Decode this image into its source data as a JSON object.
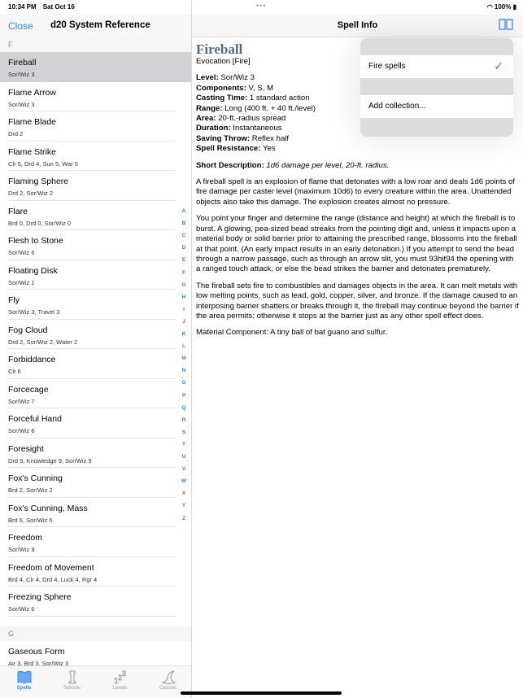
{
  "status": {
    "time": "10:34 PM",
    "date": "Sat Oct 16",
    "battery": "100%"
  },
  "left": {
    "close": "Close",
    "title": "d20 System Reference",
    "sections": [
      {
        "letter": "F",
        "items": [
          {
            "name": "Fireball",
            "sub": "Sor/Wiz 3",
            "selected": true
          },
          {
            "name": "Flame Arrow",
            "sub": "Sor/Wiz 3"
          },
          {
            "name": "Flame Blade",
            "sub": "Drd 2"
          },
          {
            "name": "Flame Strike",
            "sub": "Clr 5, Drd 4, Sun 5, War 5"
          },
          {
            "name": "Flaming Sphere",
            "sub": "Drd 2, Sor/Wiz 2"
          },
          {
            "name": "Flare",
            "sub": "Brd 0, Drd 0, Sor/Wiz 0"
          },
          {
            "name": "Flesh to Stone",
            "sub": "Sor/Wiz 6"
          },
          {
            "name": "Floating Disk",
            "sub": "Sor/Wiz 1"
          },
          {
            "name": "Fly",
            "sub": "Sor/Wiz 3, Travel 3"
          },
          {
            "name": "Fog Cloud",
            "sub": "Drd 2, Sor/Wiz 2, Water 2"
          },
          {
            "name": "Forbiddance",
            "sub": "Clr 6"
          },
          {
            "name": "Forcecage",
            "sub": "Sor/Wiz 7"
          },
          {
            "name": "Forceful Hand",
            "sub": "Sor/Wiz 6"
          },
          {
            "name": "Foresight",
            "sub": "Drd 9, Knowledge 9, Sor/Wiz 9"
          },
          {
            "name": "Fox's Cunning",
            "sub": "Brd 2, Sor/Wiz 2"
          },
          {
            "name": "Fox's Cunning, Mass",
            "sub": "Brd 6, Sor/Wiz 6"
          },
          {
            "name": "Freedom",
            "sub": "Sor/Wiz 9"
          },
          {
            "name": "Freedom of Movement",
            "sub": "Brd 4, Clr 4, Drd 4, Luck 4, Rgr 4"
          },
          {
            "name": "Freezing Sphere",
            "sub": "Sor/Wiz 6"
          }
        ]
      },
      {
        "letter": "G",
        "items": [
          {
            "name": "Gaseous Form",
            "sub": "Air 3, Brd 3, Sor/Wiz 3"
          }
        ]
      }
    ],
    "index": [
      "A",
      "B",
      "C",
      "D",
      "E",
      "F",
      "G",
      "H",
      "I",
      "J",
      "K",
      "L",
      "M",
      "N",
      "O",
      "P",
      "Q",
      "R",
      "S",
      "T",
      "U",
      "V",
      "W",
      "X",
      "Y",
      "Z"
    ],
    "tabs": [
      {
        "label": "Spells",
        "icon": "book-icon",
        "active": true
      },
      {
        "label": "Schools",
        "icon": "tower-icon"
      },
      {
        "label": "Levels",
        "icon": "numbers-icon"
      },
      {
        "label": "Classes",
        "icon": "wizard-hat-icon"
      }
    ]
  },
  "detail": {
    "nav_title": "Spell Info",
    "name": "Fireball",
    "school": "Evocation [Fire]",
    "stats": [
      {
        "k": "Level:",
        "v": " Sor/Wiz 3"
      },
      {
        "k": "Components:",
        "v": " V, S, M"
      },
      {
        "k": "Casting Time:",
        "v": " 1 standard action"
      },
      {
        "k": "Range:",
        "v": " Long (400 ft. + 40 ft./level)"
      },
      {
        "k": "Area:",
        "v": " 20-ft.-radius spread"
      },
      {
        "k": "Duration:",
        "v": " Instantaneous"
      },
      {
        "k": "Saving Throw:",
        "v": " Reflex half"
      },
      {
        "k": "Spell Resistance:",
        "v": " Yes"
      }
    ],
    "short_label": "Short Description:",
    "short": "1d6 damage per level, 20-ft. radius.",
    "paragraphs": [
      "A fireball spell is an explosion of flame that detonates with a low roar and deals 1d6 points of fire damage per caster level (maximum 10d6) to every creature within the area. Unattended objects also take this damage. The explosion creates almost no pressure.",
      "You point your finger and determine the range (distance and height) at which the fireball is to burst. A glowing, pea-sized bead streaks from the pointing digit and, unless it impacts upon a material body or solid barrier prior to attaining the prescribed range, blossoms into the fireball at that point. (An early impact results in an early detonation.) If you attempt to send the bead through a narrow passage, such as through an arrow slit, you must 93hit94 the opening with a ranged touch attack, or else the bead strikes the barrier and detonates prematurely.",
      "The fireball sets fire to combustibles and damages objects in the area. It can melt metals with low melting points, such as lead, gold, copper, silver, and bronze. If the damage caused to an interposing barrier shatters or breaks through it, the fireball may continue beyond the barrier if the area permits; otherwise it stops at the barrier just as any other spell effect does.",
      "Material Component: A tiny ball of bat guano and sulfur."
    ]
  },
  "popover": {
    "items": [
      {
        "label": "Fire spells",
        "checked": true
      },
      {
        "label": "Add collection..."
      }
    ]
  },
  "colors": {
    "accent": "#2f86f6",
    "title": "#4a6d96",
    "selected": "#d1d1d6"
  }
}
